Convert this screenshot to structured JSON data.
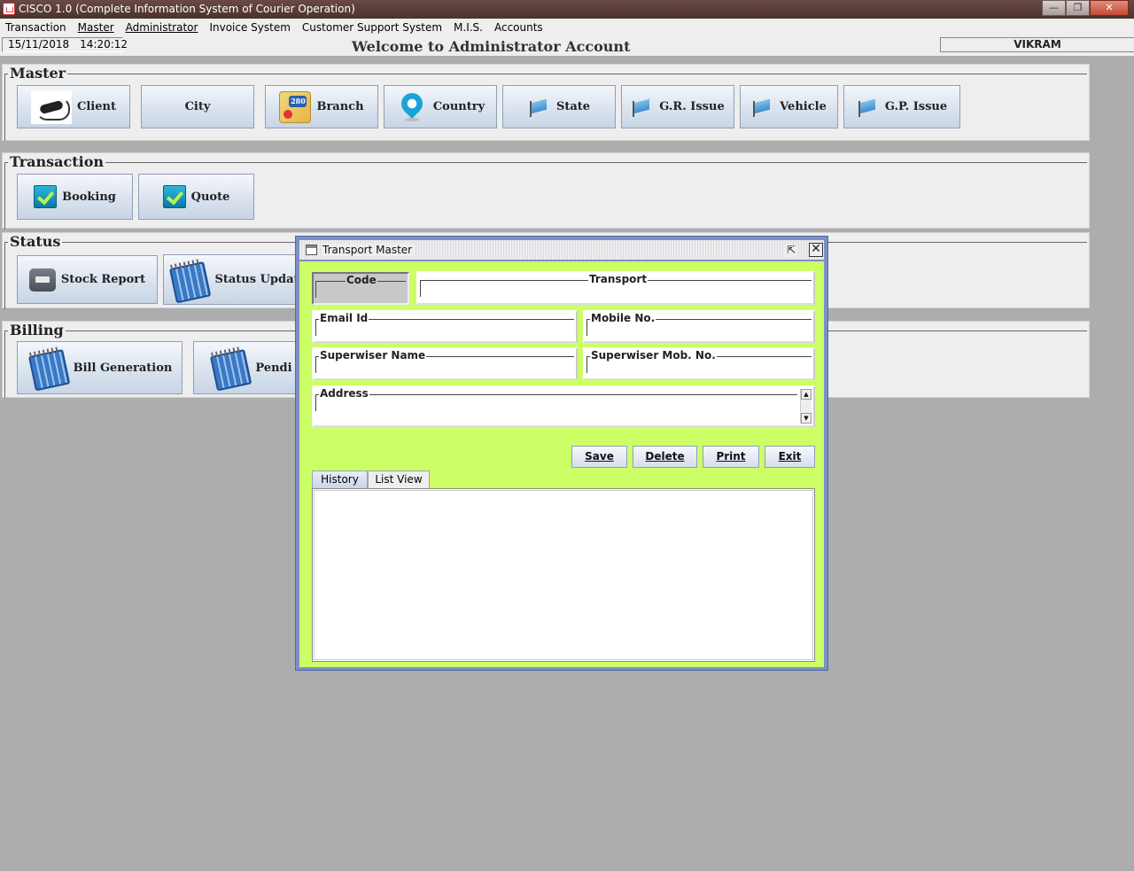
{
  "window": {
    "title": "CISCO 1.0 (Complete Information System of Courier Operation)",
    "minimize": "—",
    "maximize": "❐",
    "close": "✕"
  },
  "menu": {
    "transaction": "Transaction",
    "master": "Master",
    "administrator": "Administrator",
    "invoice": "Invoice System",
    "customer_support": "Customer Support System",
    "mis": "M.I.S.",
    "accounts": "Accounts"
  },
  "status": {
    "date": "15/11/2018",
    "time": "14:20:12",
    "welcome": "Welcome to Administrator Account",
    "user": "VIKRAM"
  },
  "master": {
    "legend": "Master",
    "buttons": {
      "client": "Client",
      "city": "City",
      "branch": "Branch",
      "country": "Country",
      "state": "State",
      "gr_issue": "G.R. Issue",
      "vehicle": "Vehicle",
      "gp_issue": "G.P. Issue"
    }
  },
  "transaction": {
    "legend": "Transaction",
    "buttons": {
      "booking": "Booking",
      "quote": "Quote"
    }
  },
  "status_panel": {
    "legend": "Status",
    "buttons": {
      "stock_report": "Stock Report",
      "status_update": "Status Updat"
    }
  },
  "billing": {
    "legend": "Billing",
    "buttons": {
      "bill_generation": "Bill Generation",
      "pending": "Pendi"
    }
  },
  "dialog": {
    "title": "Transport Master",
    "fields": {
      "code": {
        "label": "Code",
        "value": ""
      },
      "transport": {
        "label": "Transport",
        "value": ""
      },
      "email": {
        "label": "Email Id",
        "value": ""
      },
      "mobile": {
        "label": "Mobile No.",
        "value": ""
      },
      "sup_name": {
        "label": "Superwiser Name",
        "value": ""
      },
      "sup_mobile": {
        "label": "Superwiser Mob. No.",
        "value": ""
      },
      "address": {
        "label": "Address",
        "value": ""
      }
    },
    "buttons": {
      "save": "Save",
      "delete": "Delete",
      "print": "Print",
      "exit": "Exit"
    },
    "tabs": {
      "history": "History",
      "list_view": "List View"
    }
  }
}
